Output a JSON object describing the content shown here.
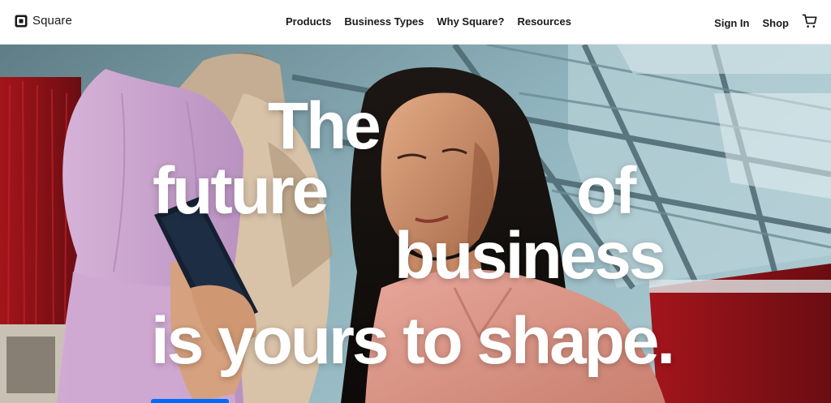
{
  "brand": {
    "name": "Square",
    "accent_color": "#006aff"
  },
  "nav": {
    "items": [
      {
        "label": "Products"
      },
      {
        "label": "Business Types"
      },
      {
        "label": "Why Square?"
      },
      {
        "label": "Resources"
      }
    ],
    "sign_in": "Sign In",
    "shop": "Shop",
    "cart_icon": "cart-icon"
  },
  "hero": {
    "headline": {
      "line1": "The",
      "line2a": "future",
      "line2b": "of",
      "line3": "business",
      "line4": "is yours to shape."
    },
    "image": "woman-holding-phone-beside-dress-form"
  }
}
